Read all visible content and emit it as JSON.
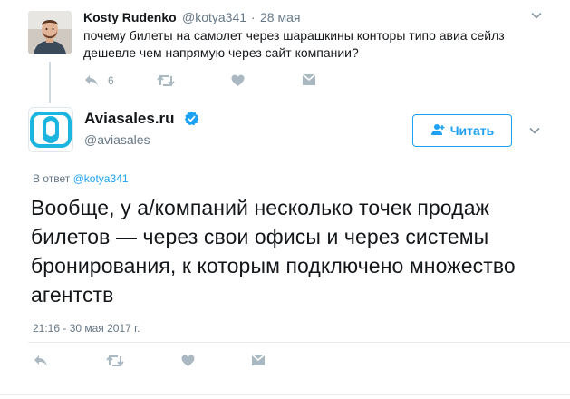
{
  "parent_tweet": {
    "name": "Kosty Rudenko",
    "handle": "@kotya341",
    "separator": "·",
    "date": "28 мая",
    "text": "почему билеты на самолет через шарашкины конторы типо авиа сейлз дешевле чем напрямую через сайт компании?",
    "reply_count": "6"
  },
  "main_tweet": {
    "name": "Aviasales.ru",
    "handle": "@aviasales",
    "follow_label": "Читать",
    "reply_to_prefix": "В ответ",
    "reply_to_handle": "@kotya341",
    "text": "Вообще, у а/компаний несколько точек продаж билетов — через свои офисы и через системы бронирования, к которым подключено множество агентств",
    "timestamp": "21:16 - 30 мая 2017 г."
  },
  "colors": {
    "accent": "#1da1f2",
    "logo_blue": "#1cb5e0",
    "icon_gray": "#aab8c2",
    "muted_text": "#657786"
  }
}
